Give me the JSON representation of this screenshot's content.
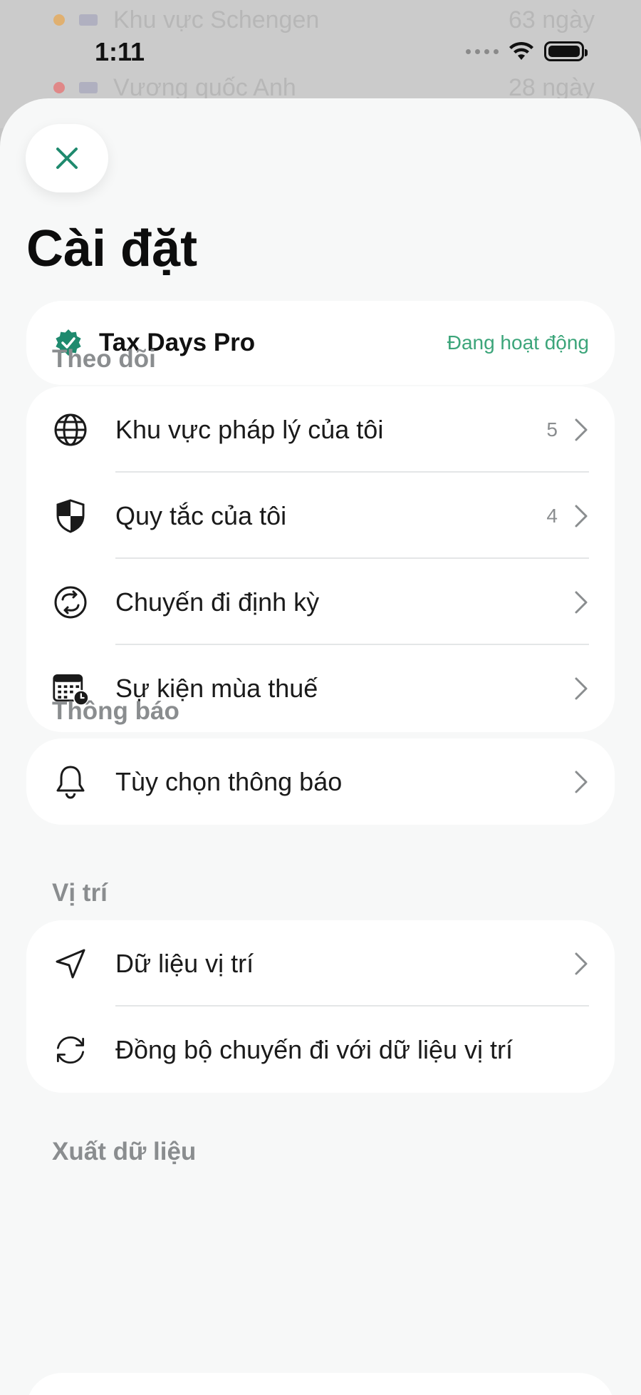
{
  "background": {
    "rows": [
      {
        "label": "Khu vực Schengen",
        "value": "63 ngày",
        "dot_color": "#d9a960"
      },
      {
        "label": "Vương quốc Anh",
        "value": "28 ngày",
        "dot_color": "#d98080"
      }
    ]
  },
  "status_bar": {
    "time": "1:11",
    "icons": [
      "signal-icon",
      "wifi-icon",
      "battery-icon"
    ]
  },
  "sheet": {
    "close_icon": "close-icon",
    "title": "Cài đặt",
    "pro": {
      "icon": "verified-badge-icon",
      "name": "Tax Days Pro",
      "status": "Đang hoạt động"
    },
    "sections": {
      "tracking": {
        "label": "Theo dõi",
        "items": [
          {
            "icon": "globe-icon",
            "label": "Khu vực pháp lý của tôi",
            "count": "5"
          },
          {
            "icon": "shield-icon",
            "label": "Quy tắc của tôi",
            "count": "4"
          },
          {
            "icon": "repeat-icon",
            "label": "Chuyến đi định kỳ",
            "count": ""
          },
          {
            "icon": "calendar-clock-icon",
            "label": "Sự kiện mùa thuế",
            "count": ""
          }
        ]
      },
      "notifications": {
        "label": "Thông báo",
        "items": [
          {
            "icon": "bell-icon",
            "label": "Tùy chọn thông báo"
          }
        ]
      },
      "location": {
        "label": "Vị trí",
        "items": [
          {
            "icon": "location-arrow-icon",
            "label": "Dữ liệu vị trí"
          },
          {
            "icon": "sync-icon",
            "label": "Đồng bộ chuyến đi với dữ liệu vị trí"
          }
        ]
      },
      "export": {
        "label": "Xuất dữ liệu"
      }
    }
  },
  "colors": {
    "accent": "#1f8a6e",
    "status_green": "#3ca57a",
    "section_gray": "#8a8d8f"
  }
}
